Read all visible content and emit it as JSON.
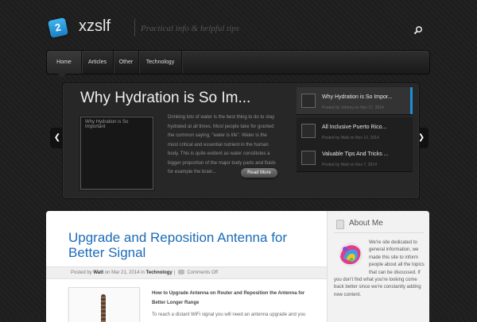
{
  "header": {
    "logo_badge": "2",
    "site_title": "xzslf",
    "tagline": "Practical info & helpful tips",
    "search_icon": "search-icon"
  },
  "nav": {
    "items": [
      {
        "label": "Home",
        "active": true
      },
      {
        "label": "Articles",
        "active": false
      },
      {
        "label": "Other",
        "active": false
      },
      {
        "label": "Technology",
        "active": false
      }
    ]
  },
  "featured": {
    "title": "Why Hydration is So Im...",
    "thumb_label": "Why Hydration is So Important",
    "excerpt": "Drinking lots of water is the best thing to do to stay hydrated at all times. Most people take for granted the common saying, \"water is life\". Water is the most critical and essential nutrient in the human body. This is quite evident as water constitutes a bigger proportion of the major body parts and fluids for example the brain...",
    "read_more": "Read More",
    "list": [
      {
        "title": "Why Hydration is So Impor...",
        "meta": "Posted by Johnny on Nov 17, 2014",
        "active": true
      },
      {
        "title": "All Inclusive Puerto Rico...",
        "meta": "Posted by Watt on Nov 12, 2014",
        "active": false
      },
      {
        "title": "Valuable Tips And Tricks ...",
        "meta": "Posted by Watt on Nov 7, 2014",
        "active": false
      }
    ],
    "prev_icon": "chevron-left-icon",
    "next_icon": "chevron-right-icon"
  },
  "post": {
    "title": "Upgrade and Reposition Antenna for Better Signal",
    "meta_posted_by": "Posted by",
    "meta_author": "Watt",
    "meta_on": "on Mar 21, 2014 in",
    "meta_category": "Technology",
    "meta_sep": "|",
    "meta_comments": "Comments Off",
    "subheading": "How to Upgrade Antenna on Router and Reposition the Antenna for Better Longer Range",
    "body": "To reach a distant WiFi signal you will need an antenna upgrade and you"
  },
  "sidebar": {
    "about_title": "About Me",
    "about_text": "We're site dedicated to general information, we made this site to inform people about all the topics that can be discussed. If you don't find what you're looking come back better since we're constantly adding new content."
  },
  "colors": {
    "accent": "#1d8fd6",
    "post_title": "#1b6bb6",
    "background": "#1e1e1e"
  }
}
